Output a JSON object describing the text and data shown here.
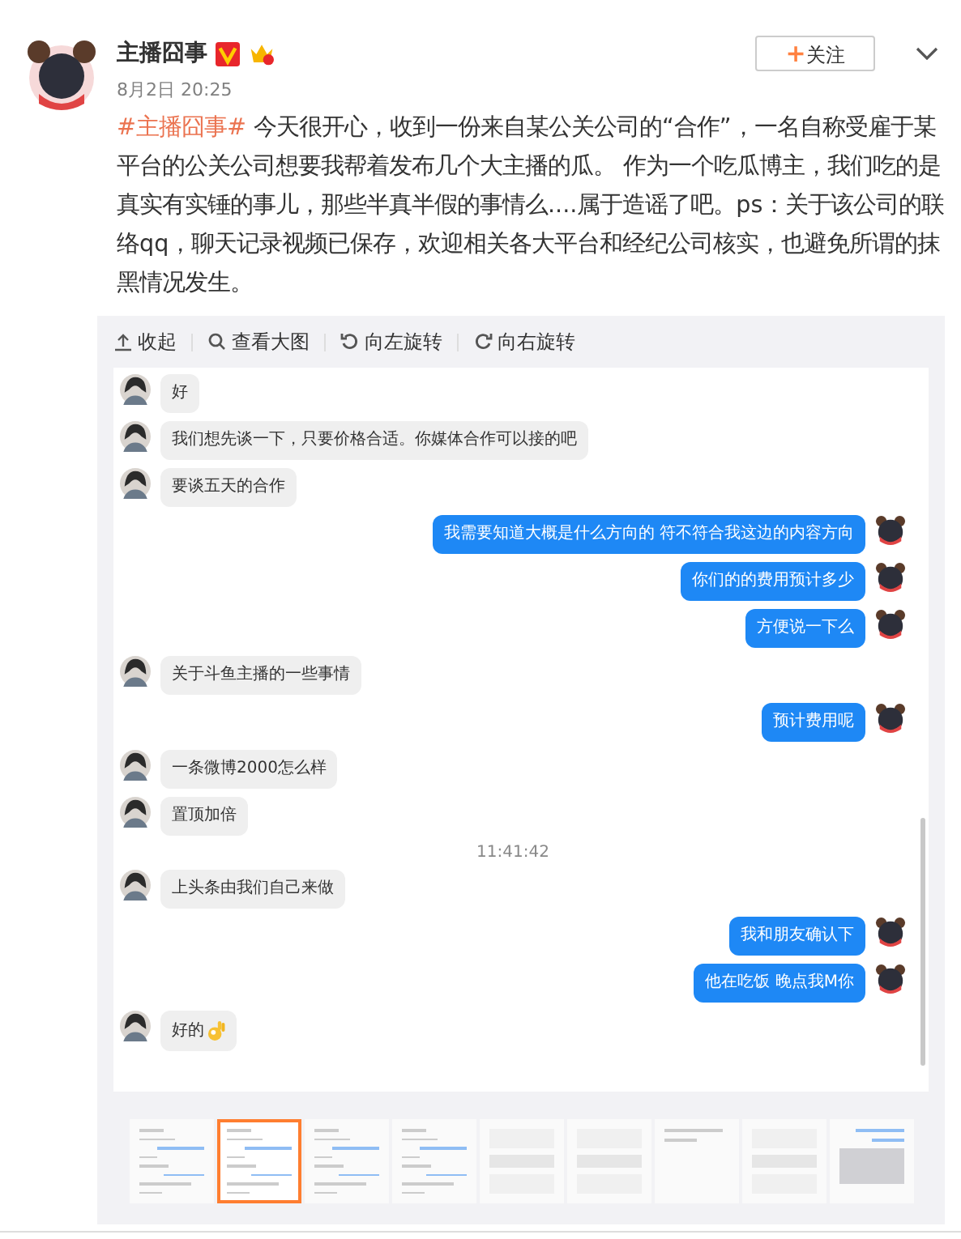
{
  "post": {
    "author": "主播囧事",
    "verified": true,
    "date": "8月2日 20:25",
    "follow_button": {
      "plus": "+",
      "label": "关注"
    },
    "hashtag": "#主播囧事#",
    "text": " 今天很开心，收到一份来自某公关公司的“合作”，一名自称受雇于某平台的公关公司想要我帮着发布几个大主播的瓜。 作为一个吃瓜博主，我们吃的是真实有实锤的事儿，那些半真半假的事情么....属于造谣了吧。ps：关于该公司的联络qq，聊天记录视频已保存，欢迎相关各大平台和经纪公司核实，也避免所谓的抹黑情况发生。"
  },
  "toolbar": [
    {
      "kind": "collapse",
      "label": "收起"
    },
    {
      "kind": "zoom",
      "label": "查看大图"
    },
    {
      "kind": "rotate_left",
      "label": "向左旋转"
    },
    {
      "kind": "rotate_right",
      "label": "向右旋转"
    }
  ],
  "chat": {
    "messages": [
      {
        "kind": "left",
        "text": "好"
      },
      {
        "kind": "left",
        "text": "我们想先谈一下，只要价格合适。你媒体合作可以接的吧"
      },
      {
        "kind": "left",
        "text": "要谈五天的合作"
      },
      {
        "kind": "right",
        "text": "我需要知道大概是什么方向的 符不符合我这边的内容方向"
      },
      {
        "kind": "right",
        "text": "你们的的费用预计多少"
      },
      {
        "kind": "right",
        "text": "方便说一下么"
      },
      {
        "kind": "left",
        "text": "关于斗鱼主播的一些事情"
      },
      {
        "kind": "right",
        "text": "预计费用呢"
      },
      {
        "kind": "left",
        "text": "一条微博2000怎么样"
      },
      {
        "kind": "left",
        "text": "置顶加倍"
      },
      {
        "kind": "time",
        "text": "11:41:42"
      },
      {
        "kind": "left",
        "text": "上头条由我们自己来做"
      },
      {
        "kind": "right",
        "text": "我和朋友确认下"
      },
      {
        "kind": "right",
        "text": "他在吃饭 晚点我M你"
      },
      {
        "kind": "left_ok",
        "text": "好的"
      }
    ]
  },
  "thumbnails": [
    {
      "kind": "chat",
      "selected": false
    },
    {
      "kind": "chat",
      "selected": true
    },
    {
      "kind": "chat",
      "selected": false
    },
    {
      "kind": "chat",
      "selected": false
    },
    {
      "kind": "blank",
      "selected": false
    },
    {
      "kind": "blank",
      "selected": false
    },
    {
      "kind": "note",
      "selected": false
    },
    {
      "kind": "blank",
      "selected": false
    },
    {
      "kind": "keyboard",
      "selected": false
    }
  ]
}
